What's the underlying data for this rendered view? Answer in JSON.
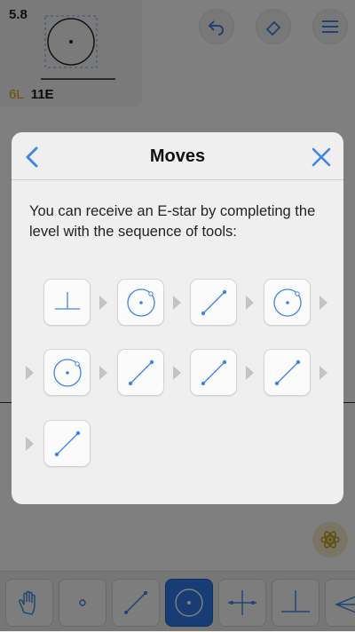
{
  "level": {
    "number": "5.8",
    "goal_l": "6L",
    "goal_e": "11E"
  },
  "dialog": {
    "title": "Moves",
    "message": "You can receive an E-star by completing the level with the sequence of tools:",
    "sequence": [
      "perpendicular-tool-icon",
      "circle-tool-icon",
      "line-tool-icon",
      "circle-tool-icon",
      "circle-tool-icon",
      "line-tool-icon",
      "line-tool-icon",
      "line-tool-icon",
      "line-tool-icon"
    ]
  },
  "toolbar": {
    "tools": [
      "move-hand-icon",
      "point-tool-icon",
      "line-tool-icon",
      "circle-tool-icon",
      "perpendicular-bisector-icon",
      "perpendicular-tool-icon",
      "angle-bisector-icon"
    ],
    "active": "circle-tool-icon"
  },
  "colors": {
    "accent": "#3d87e3",
    "goal_l": "#e0a100",
    "active_tool": "#2f7be8"
  }
}
